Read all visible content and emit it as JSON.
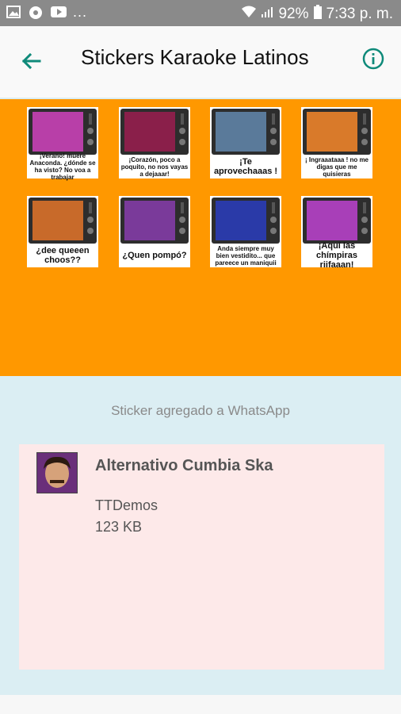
{
  "status_bar": {
    "overflow": "...",
    "battery_percent": "92%",
    "time": "7:33 p. m."
  },
  "toolbar": {
    "title": "Stickers Karaoke Latinos",
    "accent_color": "#0f8a7a"
  },
  "stickers": [
    {
      "caption": "¡Verano! muere Anaconda. ¿dónde se ha visto? No voa a trabajar",
      "screen_color": "#b83fa8"
    },
    {
      "caption": "¡Corazón, poco a poquito, no nos vayas a dejaaar!",
      "screen_color": "#8a1f4a"
    },
    {
      "caption": "¡Te aprovechaaas !",
      "screen_color": "#5a7a9a"
    },
    {
      "caption": "¡ Ingraaataaa ! no me digas que me quisieras",
      "screen_color": "#d97a2a"
    },
    {
      "caption": "¿dee queeen choos??",
      "screen_color": "#c86a2a"
    },
    {
      "caption": "¿Quen pompó?",
      "screen_color": "#7a3a9a"
    },
    {
      "caption": "Anda siempre muy bien vestidito... que pareece un maniquii",
      "screen_color": "#2a3aa8"
    },
    {
      "caption": "¡Aquí las chímpiras riifaaan!",
      "screen_color": "#a83fb8"
    }
  ],
  "status_message": "Sticker agregado a WhatsApp",
  "pack": {
    "name": "Alternativo Cumbia Ska",
    "author": "TTDemos",
    "size": "123 KB"
  },
  "colors": {
    "sticker_panel_bg": "#ff9800",
    "page_bg": "#dbeef3",
    "card_bg": "#fde9e9"
  }
}
